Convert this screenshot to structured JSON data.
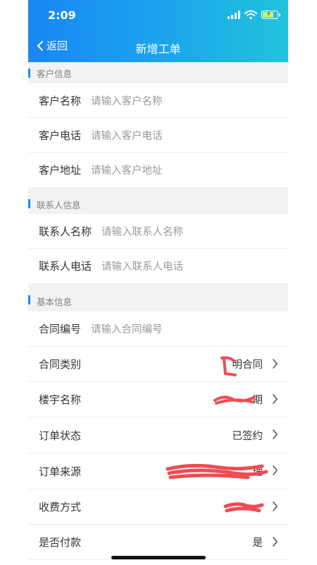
{
  "status": {
    "time": "2:09"
  },
  "nav": {
    "back_label": "返回",
    "title": "新增工单"
  },
  "sections": {
    "customer": {
      "title": "客户信息",
      "rows": [
        {
          "label": "客户名称",
          "placeholder": "请输入客户名称"
        },
        {
          "label": "客户电话",
          "placeholder": "请输入客户电话"
        },
        {
          "label": "客户地址",
          "placeholder": "请输入客户地址"
        }
      ]
    },
    "contact": {
      "title": "联系人信息",
      "rows": [
        {
          "label": "联系人名称",
          "placeholder": "请输入联系人名称"
        },
        {
          "label": "联系人电话",
          "placeholder": "请输入联系人电话"
        }
      ]
    },
    "basic": {
      "title": "基本信息",
      "contract_no": {
        "label": "合同编号",
        "placeholder": "请输入合同编号"
      },
      "selects": [
        {
          "label": "合同类别",
          "value": "明合同"
        },
        {
          "label": "楼宇名称",
          "value": "期"
        },
        {
          "label": "订单状态",
          "value": "已签约"
        },
        {
          "label": "订单来源",
          "value": "理"
        },
        {
          "label": "收费方式",
          "value": ""
        },
        {
          "label": "是否付款",
          "value": "是"
        }
      ]
    }
  },
  "colors": {
    "header_start": "#1a86f4",
    "header_end": "#22c3dc",
    "accent": "#1a8cf0",
    "redaction": "#f04b55"
  }
}
